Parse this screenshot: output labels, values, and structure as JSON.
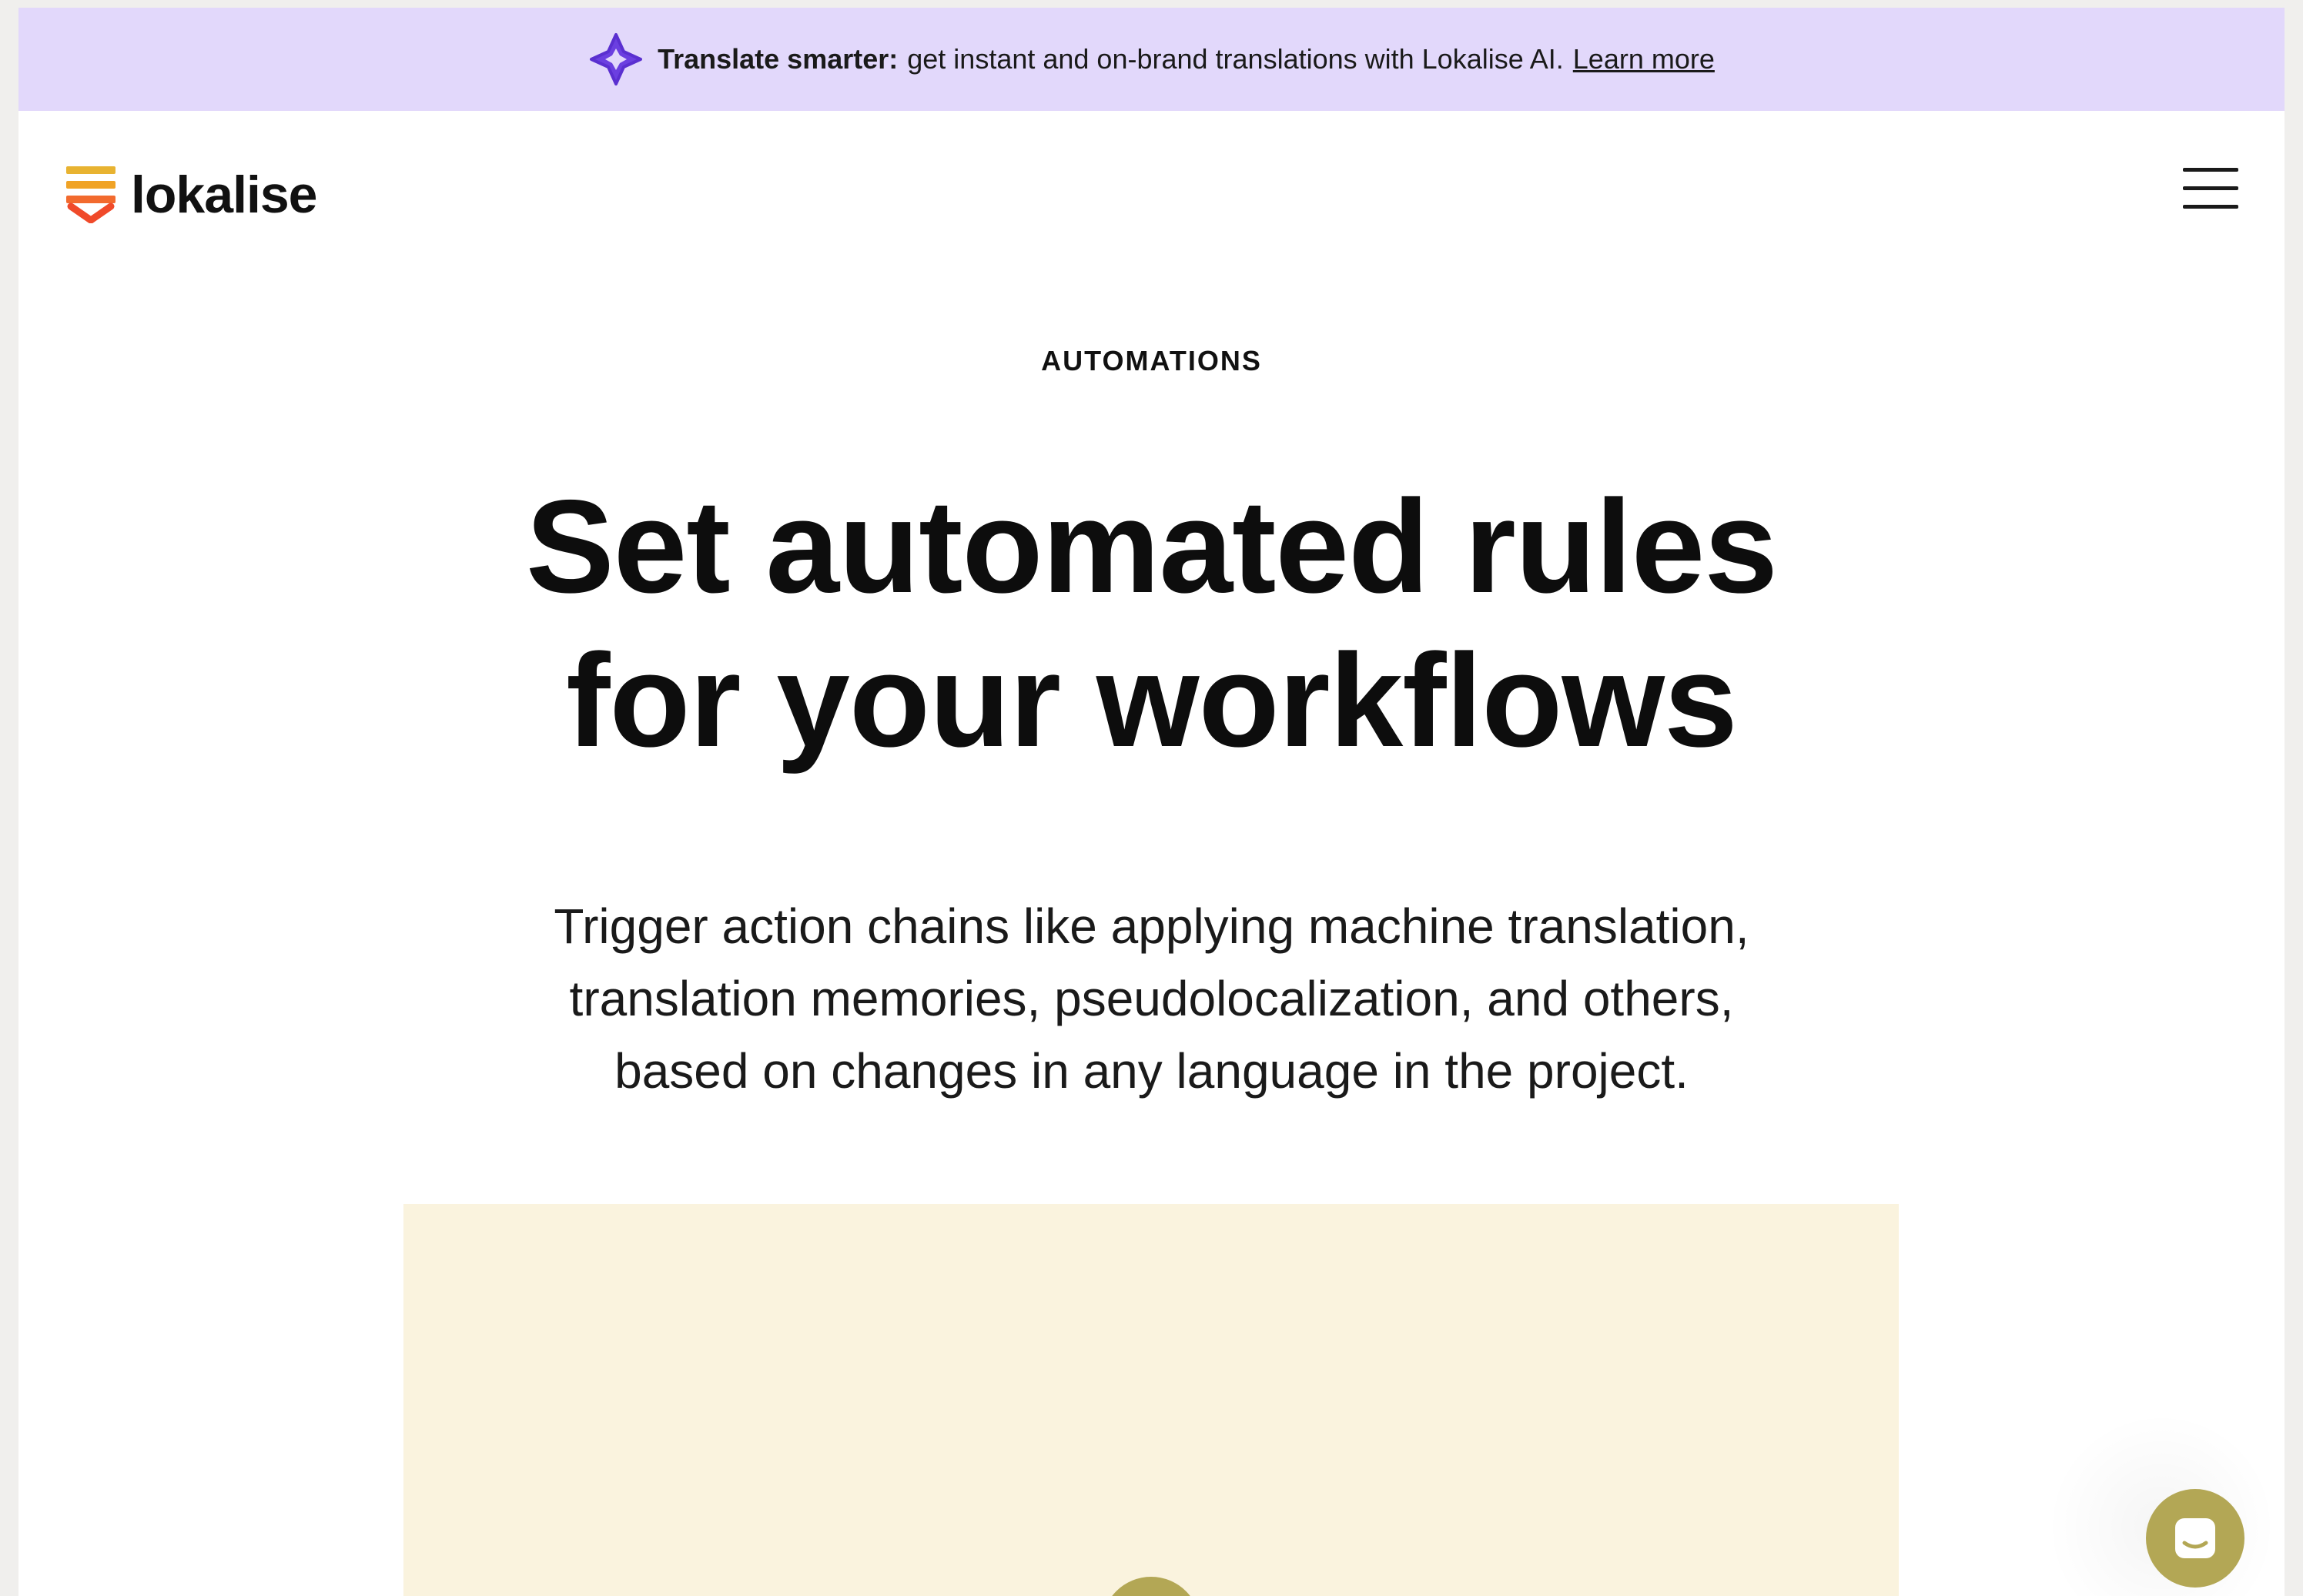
{
  "banner": {
    "bold_text": "Translate smarter:",
    "text": "get instant and on-brand translations with Lokalise AI.",
    "link_text": "Learn more",
    "icon": "sparkle-icon",
    "icon_color": "#6b3fe0"
  },
  "header": {
    "logo_text": "lokalise",
    "logo_icon": "lokalise-logo-icon",
    "menu_icon": "hamburger-menu-icon"
  },
  "hero": {
    "eyebrow": "AUTOMATIONS",
    "headline_line1": "Set automated rules",
    "headline_line2": "for your workflows",
    "subtext_line1": "Trigger action chains like applying machine translation,",
    "subtext_line2": "translation memories, pseudolocalization, and others,",
    "subtext_line3": "based on changes in any language in the project."
  },
  "colors": {
    "banner_bg": "#e2d8fb",
    "accent_olive": "#b3a755",
    "panel_bg": "#faf3de",
    "text": "#0d0d0d"
  },
  "chat": {
    "icon": "chat-icon"
  }
}
